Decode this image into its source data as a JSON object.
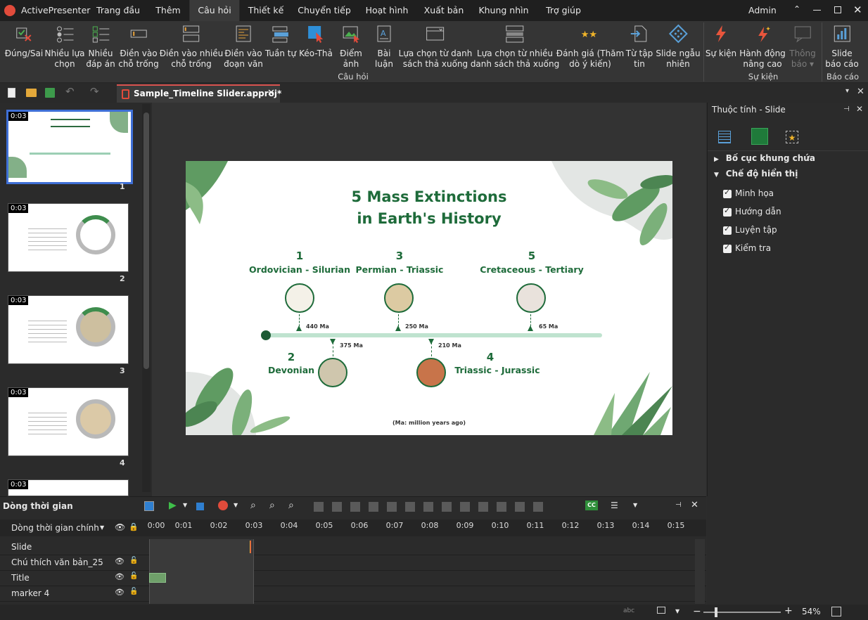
{
  "app": {
    "name": "ActivePresenter",
    "user": "Admin"
  },
  "menu": [
    "Trang đầu",
    "Thêm",
    "Câu hỏi",
    "Thiết kế",
    "Chuyển tiếp",
    "Hoạt hình",
    "Xuất bản",
    "Khung nhìn",
    "Trợ giúp"
  ],
  "ribbon": {
    "buttons": [
      {
        "line1": "Đúng/Sai",
        "line2": ""
      },
      {
        "line1": "Nhiều lựa",
        "line2": "chọn"
      },
      {
        "line1": "Nhiều",
        "line2": "đáp án"
      },
      {
        "line1": "Điền vào",
        "line2": "chỗ trống"
      },
      {
        "line1": "Điền vào nhiều",
        "line2": "chỗ trống"
      },
      {
        "line1": "Điền vào",
        "line2": "đoạn văn"
      },
      {
        "line1": "Tuần tự",
        "line2": ""
      },
      {
        "line1": "Kéo-Thả",
        "line2": ""
      },
      {
        "line1": "Điểm",
        "line2": "ảnh"
      },
      {
        "line1": "Bài",
        "line2": "luận"
      },
      {
        "line1": "Lựa chọn từ danh",
        "line2": "sách thả xuống"
      },
      {
        "line1": "Lựa chọn từ nhiều",
        "line2": "danh sách thả xuống"
      },
      {
        "line1": "Đánh giá (Thăm",
        "line2": "dò ý kiến)"
      },
      {
        "line1": "Từ tập",
        "line2": "tin"
      },
      {
        "line1": "Slide ngẫu",
        "line2": "nhiên"
      },
      {
        "line1": "Sự kiện",
        "line2": ""
      },
      {
        "line1": "Hành động",
        "line2": "nâng cao"
      },
      {
        "line1": "Thông",
        "line2": "báo ▾"
      },
      {
        "line1": "Slide",
        "line2": "báo cáo"
      }
    ],
    "groups": [
      "Câu hỏi",
      "Sự kiện",
      "Báo cáo"
    ]
  },
  "document_tab": "Sample_Timeline Slider.approj*",
  "slides": [
    {
      "time": "0:03",
      "number": "1"
    },
    {
      "time": "0:03",
      "number": "2"
    },
    {
      "time": "0:03",
      "number": "3"
    },
    {
      "time": "0:03",
      "number": "4"
    },
    {
      "time": "0:03",
      "number": ""
    }
  ],
  "slide": {
    "title_line1": "5 Mass Extinctions",
    "title_line2": "in Earth's History",
    "events": [
      {
        "num": "1",
        "name": "Ordovician - Silurian",
        "ma": "440 Ma"
      },
      {
        "num": "2",
        "name": "Devonian",
        "ma": "375 Ma"
      },
      {
        "num": "3",
        "name": "Permian - Triassic",
        "ma": "250 Ma"
      },
      {
        "num": "4",
        "name": "Triassic - Jurassic",
        "ma": "210 Ma"
      },
      {
        "num": "5",
        "name": "Cretaceous - Tertiary",
        "ma": "65 Ma"
      }
    ],
    "footnote": "(Ma: million years ago)"
  },
  "properties": {
    "title": "Thuộc tính - Slide",
    "sections": [
      "Bố cục khung chứa",
      "Chế độ hiển thị"
    ],
    "checks": [
      "Minh họa",
      "Hướng dẫn",
      "Luyện tập",
      "Kiểm tra"
    ]
  },
  "timeline": {
    "title": "Dòng thời gian",
    "main": "Dòng thời gian chính",
    "ticks": [
      "0:00",
      "0:01",
      "0:02",
      "0:03",
      "0:04",
      "0:05",
      "0:06",
      "0:07",
      "0:08",
      "0:09",
      "0:10",
      "0:11",
      "0:12",
      "0:13",
      "0:14",
      "0:15"
    ],
    "rows": [
      "Slide",
      "Chú thích văn bản_25",
      "Title",
      "marker 4"
    ]
  },
  "status": {
    "zoom": "54%"
  },
  "colors": {
    "accent": "#1e6b3a",
    "track": "#bfe3cf",
    "dot": "#1d5a34"
  }
}
